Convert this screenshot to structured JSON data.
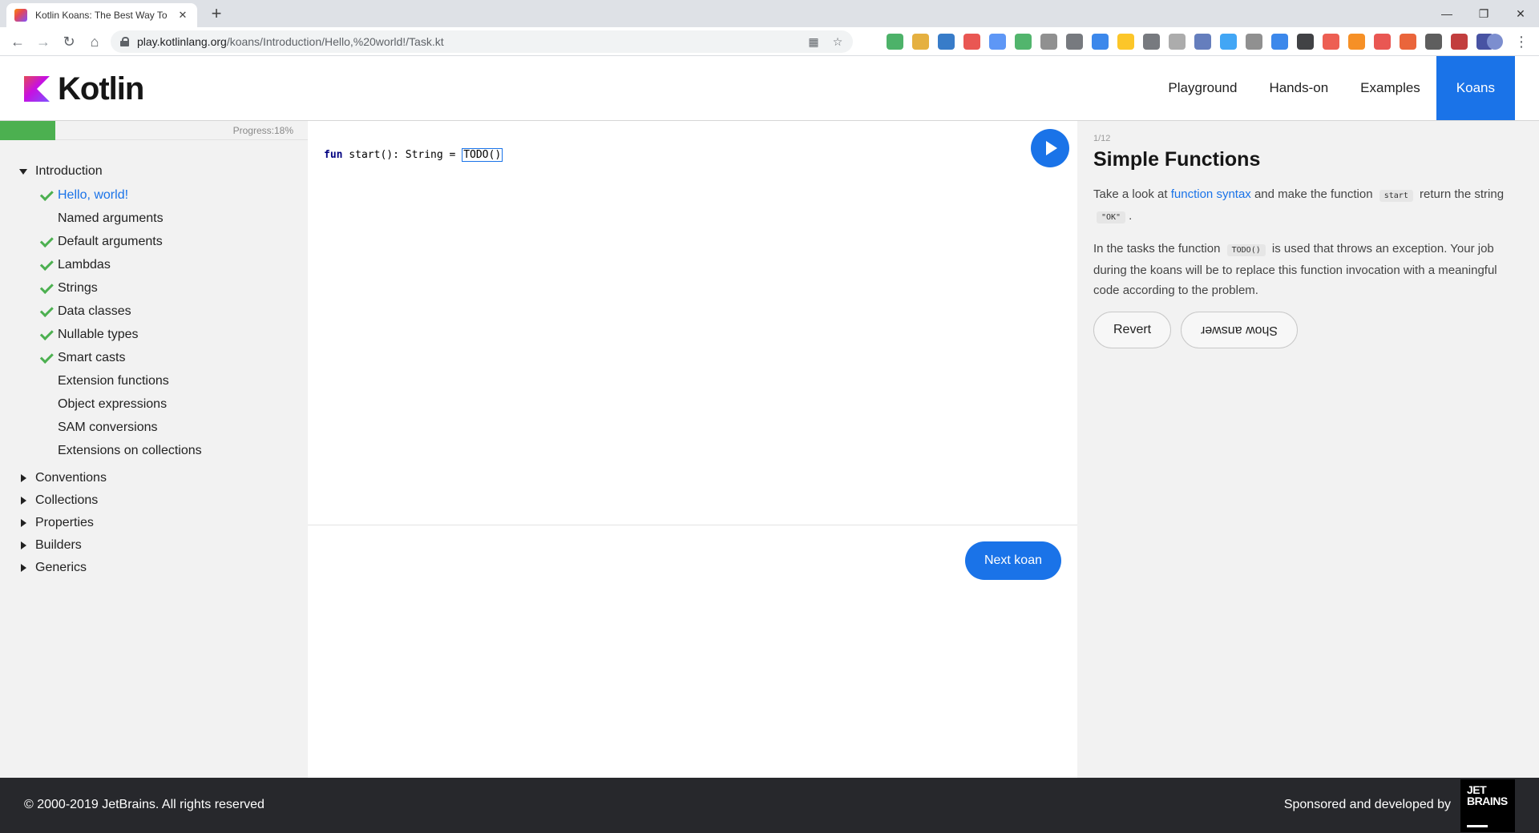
{
  "browser": {
    "tab_title": "Kotlin Koans: The Best Way To",
    "tab_close": "✕",
    "new_tab": "+",
    "url_host": "play.kotlinlang.org",
    "url_path": "/koans/Introduction/Hello,%20world!/Task.kt",
    "window_buttons": {
      "minimize": "—",
      "restore": "❐",
      "close": "✕"
    },
    "extension_colors": [
      "#2ea44f",
      "#e1a21f",
      "#1565c0",
      "#e53935",
      "#4285f4",
      "#34a853",
      "#7d7d7d",
      "#5f6368",
      "#1a73e8",
      "#fbbc04",
      "#5f6368",
      "#9e9e9e",
      "#4a67b1",
      "#2196f3",
      "#7d7d7d",
      "#1a73e8",
      "#202124",
      "#ea4335",
      "#f57c00",
      "#e53935",
      "#e64a19",
      "#424242",
      "#b71c1c",
      "#283593"
    ]
  },
  "header": {
    "logo_text": "Kotlin",
    "nav": [
      {
        "label": "Playground",
        "active": false
      },
      {
        "label": "Hands-on",
        "active": false
      },
      {
        "label": "Examples",
        "active": false
      },
      {
        "label": "Koans",
        "active": true
      }
    ]
  },
  "progress": {
    "label": "Progress:18%",
    "value": 0.18
  },
  "sidebar": {
    "introduction": {
      "label": "Introduction",
      "items": [
        {
          "label": "Hello, world!",
          "done": true,
          "current": true
        },
        {
          "label": "Named arguments",
          "done": false,
          "current": false
        },
        {
          "label": "Default arguments",
          "done": true,
          "current": false
        },
        {
          "label": "Lambdas",
          "done": true,
          "current": false
        },
        {
          "label": "Strings",
          "done": true,
          "current": false
        },
        {
          "label": "Data classes",
          "done": true,
          "current": false
        },
        {
          "label": "Nullable types",
          "done": true,
          "current": false
        },
        {
          "label": "Smart casts",
          "done": true,
          "current": false
        },
        {
          "label": "Extension functions",
          "done": false,
          "current": false
        },
        {
          "label": "Object expressions",
          "done": false,
          "current": false
        },
        {
          "label": "SAM conversions",
          "done": false,
          "current": false
        },
        {
          "label": "Extensions on collections",
          "done": false,
          "current": false
        }
      ]
    },
    "collapsed_sections": [
      "Conventions",
      "Collections",
      "Properties",
      "Builders",
      "Generics"
    ]
  },
  "editor": {
    "keyword": "fun",
    "signature": " start(): String = ",
    "todo": "TODO()",
    "next_label": "Next koan"
  },
  "task": {
    "counter": "1/12",
    "title": "Simple Functions",
    "p1_before": "Take a look at ",
    "p1_link": "function syntax",
    "p1_mid": " and make the function ",
    "p1_code1": "start",
    "p1_after": " return the string ",
    "p1_code2": "\"OK\"",
    "p1_end": ".",
    "p2_before": "In the tasks the function ",
    "p2_code": "TODO()",
    "p2_after": " is used that throws an exception. Your job during the koans will be to replace this function invocation with a meaningful code according to the problem.",
    "revert_label": "Revert",
    "show_answer_label": "Show answer"
  },
  "footer": {
    "copyright": "© 2000-2019 JetBrains. All rights reserved",
    "sponsor": "Sponsored and developed by",
    "jb_line1": "JET",
    "jb_line2": "BRAINS"
  }
}
